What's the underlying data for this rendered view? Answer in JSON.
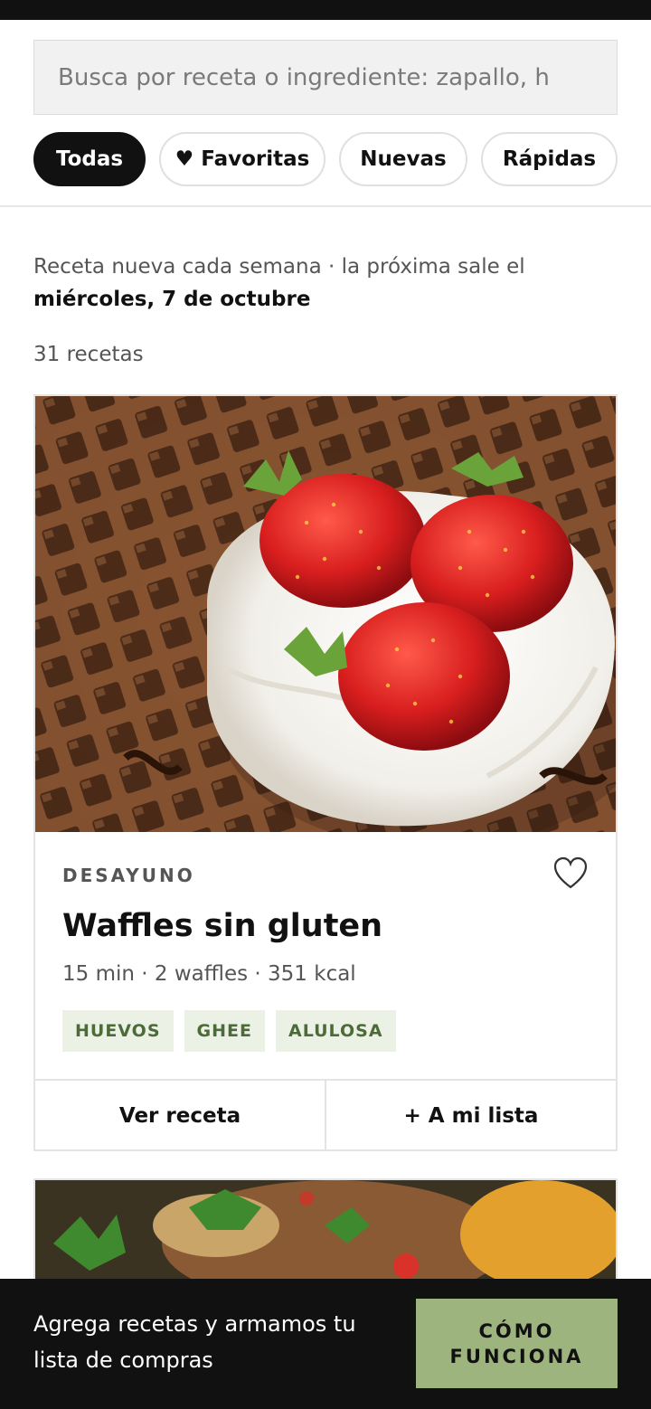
{
  "search": {
    "placeholder": "Busca por receta o ingrediente: zapallo, h"
  },
  "filters": [
    {
      "label": "Todas",
      "active": true
    },
    {
      "label": "♥ Favoritas",
      "active": false
    },
    {
      "label": "Nuevas",
      "active": false
    },
    {
      "label": "Rápidas",
      "active": false
    }
  ],
  "info": {
    "line": "Receta nueva cada semana · la próxima sale el",
    "date": "miércoles, 7 de octubre",
    "count": "31 recetas"
  },
  "recipe": {
    "category": "DESAYUNO",
    "title": "Waffles sin gluten",
    "meta": "15 min · 2 waffles · 351 kcal",
    "tags": [
      "HUEVOS",
      "GHEE",
      "ALULOSA"
    ],
    "view_label": "Ver receta",
    "add_label": "+ A mi lista",
    "favorite_icon": "heart-outline-icon"
  },
  "bottom_bar": {
    "text": "Agrega recetas y armamos tu lista de compras",
    "cta_label": "CÓMO FUNCIONA"
  },
  "colors": {
    "dark": "#111111",
    "accent_green": "#9db47e",
    "tag_bg": "#ebf1e4",
    "tag_text": "#4c6b39"
  }
}
